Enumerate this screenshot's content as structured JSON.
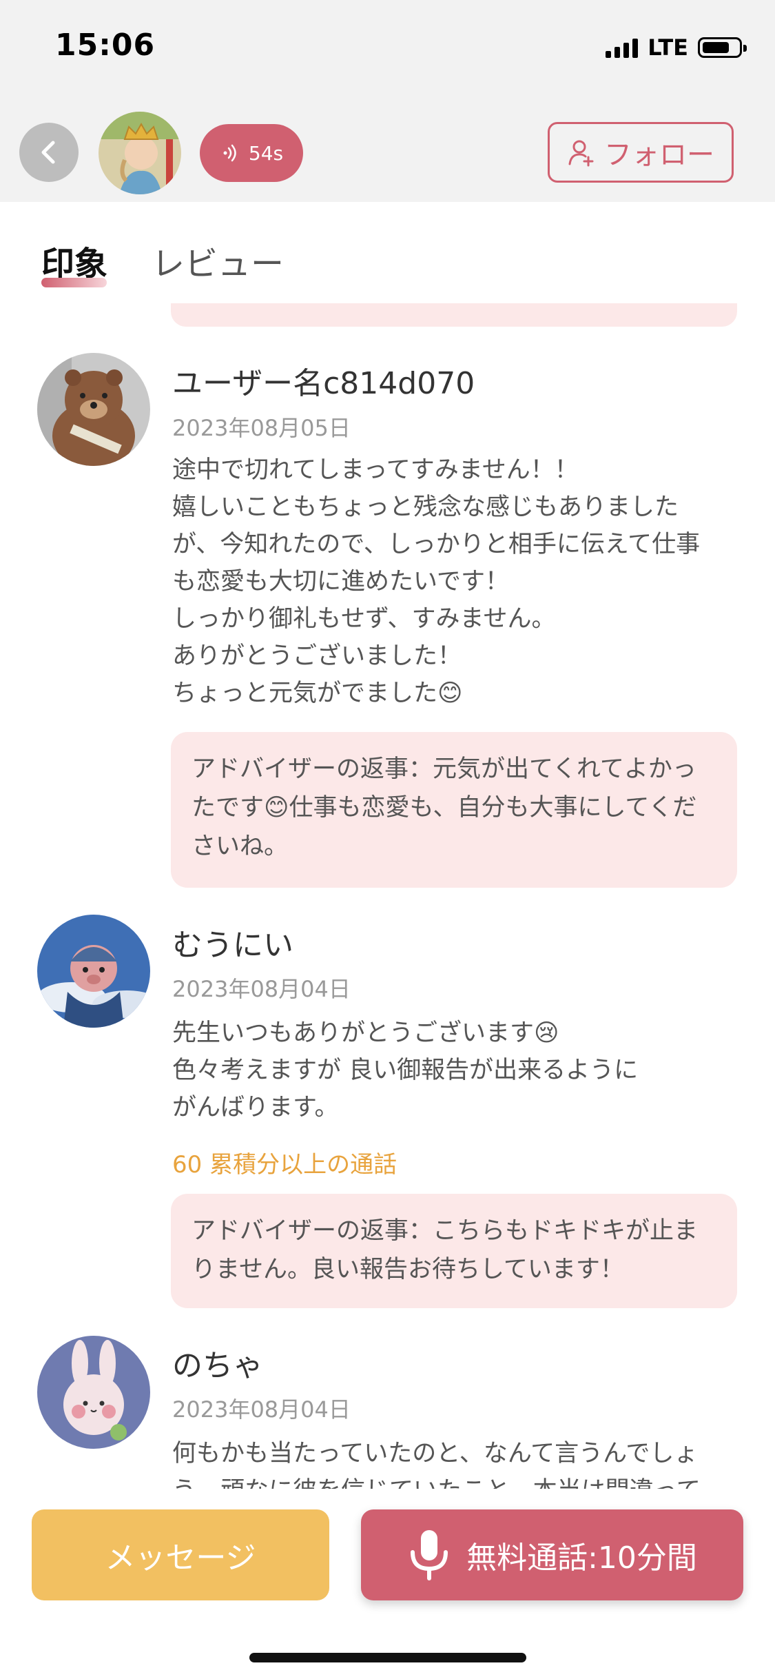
{
  "status_bar": {
    "time": "15:06",
    "network": "LTE"
  },
  "header": {
    "call_timer": "54s",
    "follow_label": "フォロー"
  },
  "tabs": [
    {
      "label": "印象",
      "active": true
    },
    {
      "label": "レビュー",
      "active": false
    }
  ],
  "reviews": [
    {
      "name": "ユーザー名c814d070",
      "date": "2023年08月05日",
      "text": "途中で切れてしまってすみません！！\n嬉しいこともちょっと残念な感じもありました\nが、今知れたので、しっかりと相手に伝えて仕事\nも恋愛も大切に進めたいです！\nしっかり御礼もせず、すみません。\nありがとうございました！\nちょっと元気がでました😊",
      "badge": "",
      "reply": "アドバイザーの返事：元気が出てくれてよかったです😊仕事も恋愛も、自分も大事にしてくださいね。"
    },
    {
      "name": "むうにい",
      "date": "2023年08月04日",
      "text": "先生いつもありがとうございます😢\n色々考えますが 良い御報告が出来るように\nがんばります。",
      "badge": "60 累積分以上の通話",
      "reply": "アドバイザーの返事：こちらもドキドキが止まりません。良い報告お待ちしています！"
    },
    {
      "name": "のちゃ",
      "date": "2023年08月04日",
      "text": "何もかも当たっていたのと、なんて言うんでしょ\nう、頑なに彼を信じていたこと、本当は間違って",
      "badge": "",
      "reply": ""
    }
  ],
  "bottom": {
    "message_label": "メッセージ",
    "call_label": "無料通話:10分間"
  },
  "colors": {
    "accent": "#d06070",
    "reply_bg": "#fce8e8",
    "message_btn": "#f2c061",
    "badge": "#e8a33d"
  }
}
